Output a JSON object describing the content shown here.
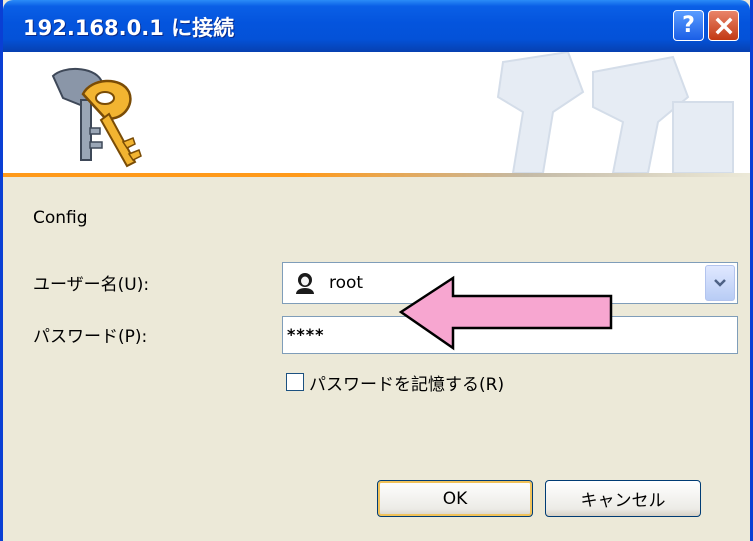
{
  "window": {
    "title": "192.168.0.1 に接続",
    "help_label": "?",
    "close_icon": "close-icon"
  },
  "banner": {
    "icon": "keys-icon",
    "watermark": "keys-watermark"
  },
  "form": {
    "realm": "Config",
    "username_label": "ユーザー名(U):",
    "username_value": "root",
    "password_label": "パスワード(P):",
    "password_value": "****",
    "remember_label": "パスワードを記憶する(R)",
    "remember_checked": false
  },
  "buttons": {
    "ok": "OK",
    "cancel": "キャンセル"
  },
  "annotation": {
    "arrow_color": "#f7a6d0",
    "arrow_outline": "#000000"
  },
  "colors": {
    "titlebar": "#0454dd",
    "dialog_bg": "#ece9d8",
    "accent_line": "#ff9a1a"
  }
}
